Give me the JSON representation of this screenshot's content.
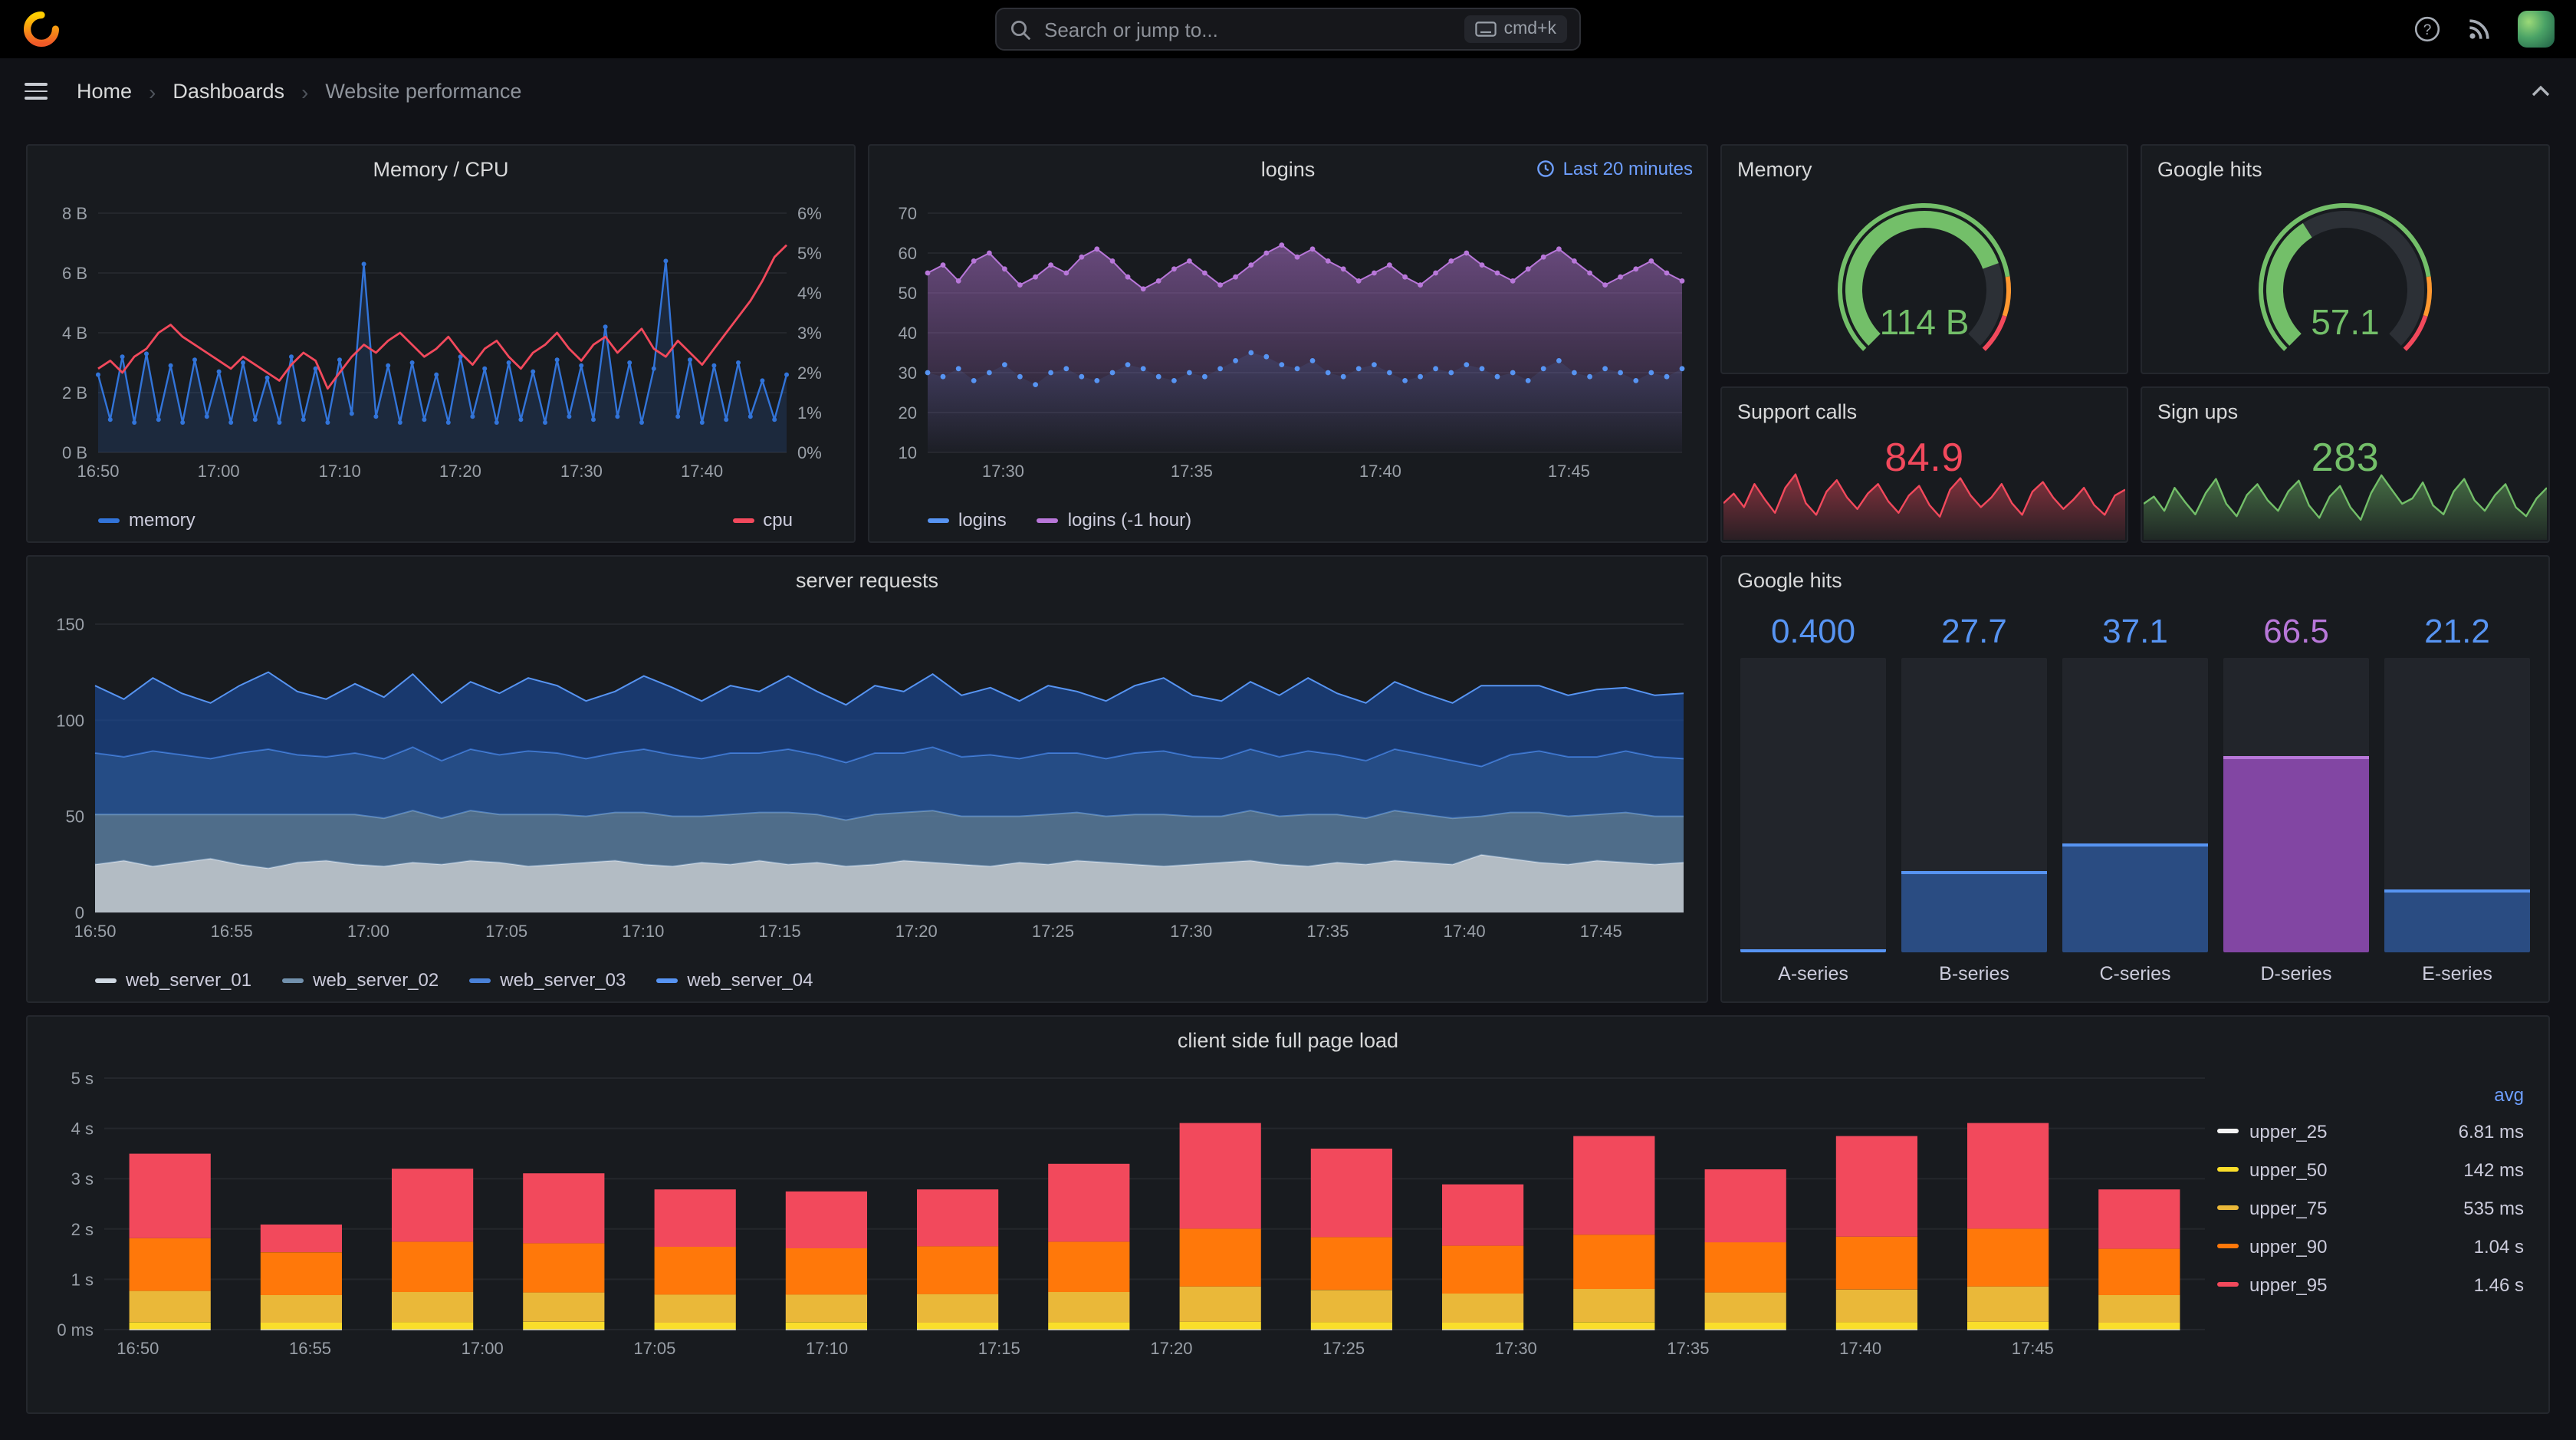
{
  "topbar": {
    "search_placeholder": "Search or jump to...",
    "shortcut_label": "cmd+k"
  },
  "breadcrumb": {
    "items": [
      "Home",
      "Dashboards",
      "Website performance"
    ]
  },
  "chart_data": [
    {
      "id": "memory_cpu",
      "type": "line",
      "title": "Memory / CPU",
      "x_ticks": [
        "16:50",
        "17:00",
        "17:10",
        "17:20",
        "17:30",
        "17:40"
      ],
      "x_tick_pos": [
        0,
        0.175,
        0.351,
        0.526,
        0.702,
        0.877
      ],
      "left_axis": {
        "min": 0,
        "max": 8,
        "ticks": [
          "0 B",
          "2 B",
          "4 B",
          "6 B",
          "8 B"
        ]
      },
      "right_axis": {
        "min": 0,
        "max": 6,
        "ticks": [
          "0%",
          "1%",
          "2%",
          "3%",
          "4%",
          "5%",
          "6%"
        ]
      },
      "series": [
        {
          "name": "memory",
          "axis": "left",
          "color": "#3274d9",
          "width": 1.2,
          "points": true,
          "point_r": 1.5,
          "fill": "rgba(50,116,217,0.16)",
          "values": [
            2.6,
            1.1,
            3.2,
            1.0,
            3.3,
            1.1,
            2.9,
            1.0,
            3.1,
            1.2,
            2.7,
            1.0,
            3.0,
            1.1,
            2.5,
            1.0,
            3.2,
            1.1,
            2.8,
            1.0,
            3.1,
            1.3,
            6.3,
            1.2,
            2.9,
            1.0,
            3.0,
            1.1,
            2.6,
            1.0,
            3.2,
            1.2,
            2.8,
            1.0,
            3.0,
            1.1,
            2.7,
            1.0,
            3.1,
            1.2,
            2.9,
            1.1,
            4.2,
            1.2,
            3.0,
            1.0,
            2.8,
            6.4,
            1.2,
            3.1,
            1.0,
            2.9,
            1.1,
            3.0,
            1.2,
            2.4,
            1.1,
            2.6
          ]
        },
        {
          "name": "cpu",
          "axis": "right",
          "color": "#f2495c",
          "width": 1.4,
          "values": [
            2.1,
            2.3,
            2.0,
            2.4,
            2.6,
            3.0,
            3.2,
            2.9,
            2.7,
            2.5,
            2.3,
            2.1,
            2.4,
            2.2,
            2.0,
            1.8,
            2.2,
            2.5,
            2.3,
            1.6,
            2.0,
            2.4,
            2.7,
            2.5,
            2.8,
            3.0,
            2.7,
            2.4,
            2.6,
            2.9,
            2.5,
            2.2,
            2.6,
            2.8,
            2.4,
            2.1,
            2.5,
            2.7,
            3.0,
            2.6,
            2.3,
            2.7,
            2.9,
            2.5,
            2.8,
            3.1,
            2.6,
            2.4,
            2.8,
            2.5,
            2.2,
            2.6,
            3.0,
            3.4,
            3.8,
            4.3,
            4.9,
            5.2
          ]
        }
      ]
    },
    {
      "id": "logins",
      "type": "line",
      "title": "logins",
      "badge": "Last 20 minutes",
      "x_ticks": [
        "17:30",
        "17:35",
        "17:40",
        "17:45"
      ],
      "x_tick_pos": [
        0.1,
        0.35,
        0.6,
        0.85
      ],
      "left_axis": {
        "min": 10,
        "max": 70,
        "ticks": [
          "10",
          "20",
          "30",
          "40",
          "50",
          "60",
          "70"
        ]
      },
      "series": [
        {
          "name": "logins (-1 hour)",
          "axis": "left",
          "color": "#b877d9",
          "width": 1,
          "points": true,
          "point_r": 1.7,
          "fill_gradient": [
            "rgba(184,119,217,0.5)",
            "rgba(184,119,217,0.02)"
          ],
          "values": [
            55,
            57,
            53,
            58,
            60,
            56,
            52,
            54,
            57,
            55,
            59,
            61,
            58,
            54,
            51,
            53,
            56,
            58,
            55,
            52,
            54,
            57,
            60,
            62,
            59,
            61,
            58,
            56,
            53,
            55,
            57,
            54,
            52,
            55,
            58,
            60,
            57,
            55,
            53,
            56,
            59,
            61,
            58,
            55,
            52,
            54,
            56,
            58,
            55,
            53
          ]
        },
        {
          "name": "logins",
          "axis": "left",
          "color": "#5794f2",
          "no_line": true,
          "points": true,
          "point_r": 1.7,
          "fill_gradient": [
            "rgba(87,148,242,0.12)",
            "rgba(87,148,242,0.01)"
          ],
          "values": [
            30,
            29,
            31,
            28,
            30,
            32,
            29,
            27,
            30,
            31,
            29,
            28,
            30,
            32,
            31,
            29,
            28,
            30,
            29,
            31,
            33,
            35,
            34,
            32,
            31,
            33,
            30,
            29,
            31,
            32,
            30,
            28,
            29,
            31,
            30,
            32,
            31,
            29,
            30,
            28,
            31,
            33,
            30,
            29,
            31,
            30,
            28,
            30,
            29,
            31
          ]
        }
      ]
    },
    {
      "id": "memory_gauge",
      "type": "gauge",
      "title": "Memory",
      "value_text": "114 B",
      "value": 114,
      "min": 0,
      "max": 150,
      "fraction": 0.76,
      "value_color": "#73bf69",
      "bar_color": "#73bf69",
      "thresholds": [
        {
          "color": "#73bf69",
          "to": 0.8
        },
        {
          "color": "#ff9830",
          "to": 0.9
        },
        {
          "color": "#f2495c",
          "to": 1
        }
      ]
    },
    {
      "id": "google_gauge",
      "type": "gauge",
      "title": "Google hits",
      "value_text": "57.1",
      "value": 57.1,
      "min": 0,
      "max": 150,
      "fraction": 0.38,
      "value_color": "#73bf69",
      "bar_color": "#73bf69",
      "thresholds": [
        {
          "color": "#73bf69",
          "to": 0.8
        },
        {
          "color": "#ff9830",
          "to": 0.9
        },
        {
          "color": "#f2495c",
          "to": 1
        }
      ]
    },
    {
      "id": "support_calls",
      "type": "sparkline",
      "title": "Support calls",
      "value_text": "84.9",
      "value_color": "#f2495c",
      "color": "#f2495c",
      "fill_top": "rgba(242,73,92,0.5)",
      "fill_bottom": "rgba(242,73,92,0.08)",
      "min": 65,
      "max": 100,
      "values": [
        80,
        85,
        78,
        90,
        82,
        75,
        88,
        95,
        80,
        74,
        86,
        92,
        83,
        77,
        85,
        90,
        81,
        75,
        84,
        89,
        79,
        73,
        87,
        93,
        84,
        78,
        83,
        90,
        80,
        74,
        86,
        91,
        83,
        77,
        82,
        88,
        79,
        74,
        84,
        87
      ]
    },
    {
      "id": "sign_ups",
      "type": "sparkline",
      "title": "Sign ups",
      "value_text": "283",
      "value_color": "#73bf69",
      "color": "#73bf69",
      "fill_top": "rgba(115,191,105,0.5)",
      "fill_bottom": "rgba(115,191,105,0.08)",
      "min": 258,
      "max": 296,
      "values": [
        274,
        278,
        270,
        283,
        275,
        268,
        280,
        288,
        274,
        267,
        279,
        285,
        276,
        270,
        281,
        287,
        273,
        266,
        278,
        284,
        272,
        265,
        280,
        290,
        282,
        274,
        277,
        286,
        273,
        268,
        281,
        288,
        276,
        270,
        279,
        285,
        272,
        267,
        277,
        283
      ]
    },
    {
      "id": "server_requests",
      "type": "area",
      "stacked": true,
      "title": "server requests",
      "x_ticks": [
        "16:50",
        "16:55",
        "17:00",
        "17:05",
        "17:10",
        "17:15",
        "17:20",
        "17:25",
        "17:30",
        "17:35",
        "17:40",
        "17:45"
      ],
      "x_tick_pos": [
        0,
        0.086,
        0.172,
        0.259,
        0.345,
        0.431,
        0.517,
        0.603,
        0.69,
        0.776,
        0.862,
        0.948
      ],
      "left_axis": {
        "min": 0,
        "max": 150,
        "ticks": [
          "0",
          "50",
          "100",
          "150"
        ]
      },
      "series": [
        {
          "name": "web_server_01",
          "color": "#cfd8e2",
          "fill": "rgba(207,216,226,0.85)",
          "values": [
            25,
            27,
            24,
            26,
            28,
            25,
            23,
            26,
            27,
            25,
            24,
            26,
            25,
            27,
            26,
            24,
            25,
            26,
            27,
            25,
            24,
            26,
            25,
            27,
            25,
            26,
            24,
            25,
            27,
            26,
            25,
            24,
            26,
            25,
            27,
            26,
            25,
            24,
            25,
            26,
            27,
            25,
            24,
            26,
            25,
            27,
            26,
            25,
            30,
            28,
            26,
            25,
            27,
            26,
            25,
            26
          ]
        },
        {
          "name": "web_server_02",
          "color": "#7291ad",
          "fill": "rgba(94,130,165,0.8)",
          "values": [
            26,
            24,
            27,
            25,
            23,
            26,
            28,
            25,
            24,
            26,
            25,
            27,
            24,
            26,
            25,
            27,
            26,
            24,
            25,
            27,
            26,
            24,
            26,
            25,
            27,
            25,
            24,
            26,
            25,
            27,
            25,
            26,
            24,
            26,
            25,
            24,
            26,
            27,
            25,
            24,
            26,
            25,
            27,
            25,
            24,
            26,
            25,
            24,
            20,
            24,
            26,
            25,
            24,
            26,
            25,
            24
          ]
        },
        {
          "name": "web_server_03",
          "color": "#4a82d9",
          "fill": "rgba(50,116,217,0.55)",
          "values": [
            32,
            30,
            33,
            31,
            29,
            32,
            34,
            31,
            30,
            32,
            31,
            33,
            30,
            32,
            31,
            33,
            32,
            30,
            31,
            33,
            32,
            30,
            32,
            31,
            33,
            31,
            30,
            32,
            31,
            33,
            31,
            32,
            30,
            32,
            31,
            30,
            32,
            33,
            31,
            30,
            32,
            31,
            33,
            31,
            30,
            32,
            31,
            30,
            26,
            30,
            32,
            31,
            30,
            32,
            31,
            30
          ]
        },
        {
          "name": "web_server_04",
          "color": "#5794f2",
          "fill": "rgba(27,78,163,0.6)",
          "values": [
            35,
            30,
            38,
            32,
            29,
            35,
            40,
            33,
            30,
            36,
            32,
            38,
            30,
            35,
            32,
            38,
            35,
            30,
            32,
            38,
            35,
            30,
            35,
            32,
            38,
            33,
            30,
            35,
            32,
            38,
            32,
            35,
            30,
            35,
            32,
            30,
            35,
            38,
            32,
            30,
            35,
            32,
            38,
            32,
            30,
            35,
            32,
            30,
            42,
            36,
            34,
            32,
            35,
            33,
            32,
            34
          ]
        }
      ]
    },
    {
      "id": "google_hits_bars",
      "type": "bar",
      "title": "Google hits",
      "max": 100,
      "columns": [
        {
          "label": "A-series",
          "value_text": "0.400",
          "value": 0.4,
          "value_color": "#5794f2",
          "fill_color": "rgba(50,116,217,0.5)",
          "edge_color": "#5794f2"
        },
        {
          "label": "B-series",
          "value_text": "27.7",
          "value": 27.7,
          "value_color": "#5794f2",
          "fill_color": "rgba(50,116,217,0.5)",
          "edge_color": "#5794f2"
        },
        {
          "label": "C-series",
          "value_text": "37.1",
          "value": 37.1,
          "value_color": "#5794f2",
          "fill_color": "rgba(50,116,217,0.5)",
          "edge_color": "#5794f2"
        },
        {
          "label": "D-series",
          "value_text": "66.5",
          "value": 66.5,
          "value_color": "#b877d9",
          "fill_color": "rgba(163,82,204,0.75)",
          "edge_color": "#b877d9"
        },
        {
          "label": "E-series",
          "value_text": "21.2",
          "value": 21.2,
          "value_color": "#5794f2",
          "fill_color": "rgba(50,116,217,0.5)",
          "edge_color": "#5794f2"
        }
      ]
    },
    {
      "id": "page_load",
      "type": "bar",
      "stacked": true,
      "title": "client side full page load",
      "legend_header": "avg",
      "x_ticks": [
        "16:50",
        "16:55",
        "17:00",
        "17:05",
        "17:10",
        "17:15",
        "17:20",
        "17:25",
        "17:30",
        "17:35",
        "17:40",
        "17:45"
      ],
      "x_tick_pos": [
        0.016,
        0.098,
        0.18,
        0.262,
        0.344,
        0.426,
        0.508,
        0.59,
        0.672,
        0.754,
        0.836,
        0.918
      ],
      "left_axis": {
        "min": 0,
        "max": 5,
        "ticks": [
          "0 ms",
          "1 s",
          "2 s",
          "3 s",
          "4 s",
          "5 s"
        ]
      },
      "series": [
        {
          "name": "upper_25",
          "avg": "6.81 ms",
          "color": "#f4f4f4",
          "values": [
            0.007,
            0.007,
            0.007,
            0.007,
            0.007,
            0.007,
            0.007,
            0.007,
            0.007,
            0.007,
            0.007,
            0.007,
            0.007,
            0.007,
            0.007,
            0.007
          ]
        },
        {
          "name": "upper_50",
          "avg": "142 ms",
          "color": "#fade2a",
          "values": [
            0.14,
            0.13,
            0.14,
            0.15,
            0.13,
            0.14,
            0.13,
            0.14,
            0.15,
            0.14,
            0.13,
            0.14,
            0.13,
            0.14,
            0.15,
            0.13
          ]
        },
        {
          "name": "upper_75",
          "avg": "535 ms",
          "color": "#eab839",
          "values": [
            0.62,
            0.55,
            0.6,
            0.58,
            0.56,
            0.55,
            0.57,
            0.6,
            0.7,
            0.64,
            0.58,
            0.66,
            0.6,
            0.65,
            0.7,
            0.55
          ]
        },
        {
          "name": "upper_90",
          "avg": "1.04 s",
          "color": "#ff780a",
          "values": [
            1.05,
            0.85,
            1.0,
            0.98,
            0.95,
            0.92,
            0.95,
            1.0,
            1.15,
            1.05,
            0.95,
            1.08,
            1.0,
            1.05,
            1.15,
            0.92
          ]
        },
        {
          "name": "upper_95",
          "avg": "1.46 s",
          "color": "#f2495c",
          "values": [
            1.68,
            0.55,
            1.45,
            1.39,
            1.14,
            1.13,
            1.13,
            1.55,
            2.1,
            1.76,
            1.22,
            1.96,
            1.45,
            2.0,
            2.1,
            1.18
          ]
        }
      ]
    }
  ]
}
